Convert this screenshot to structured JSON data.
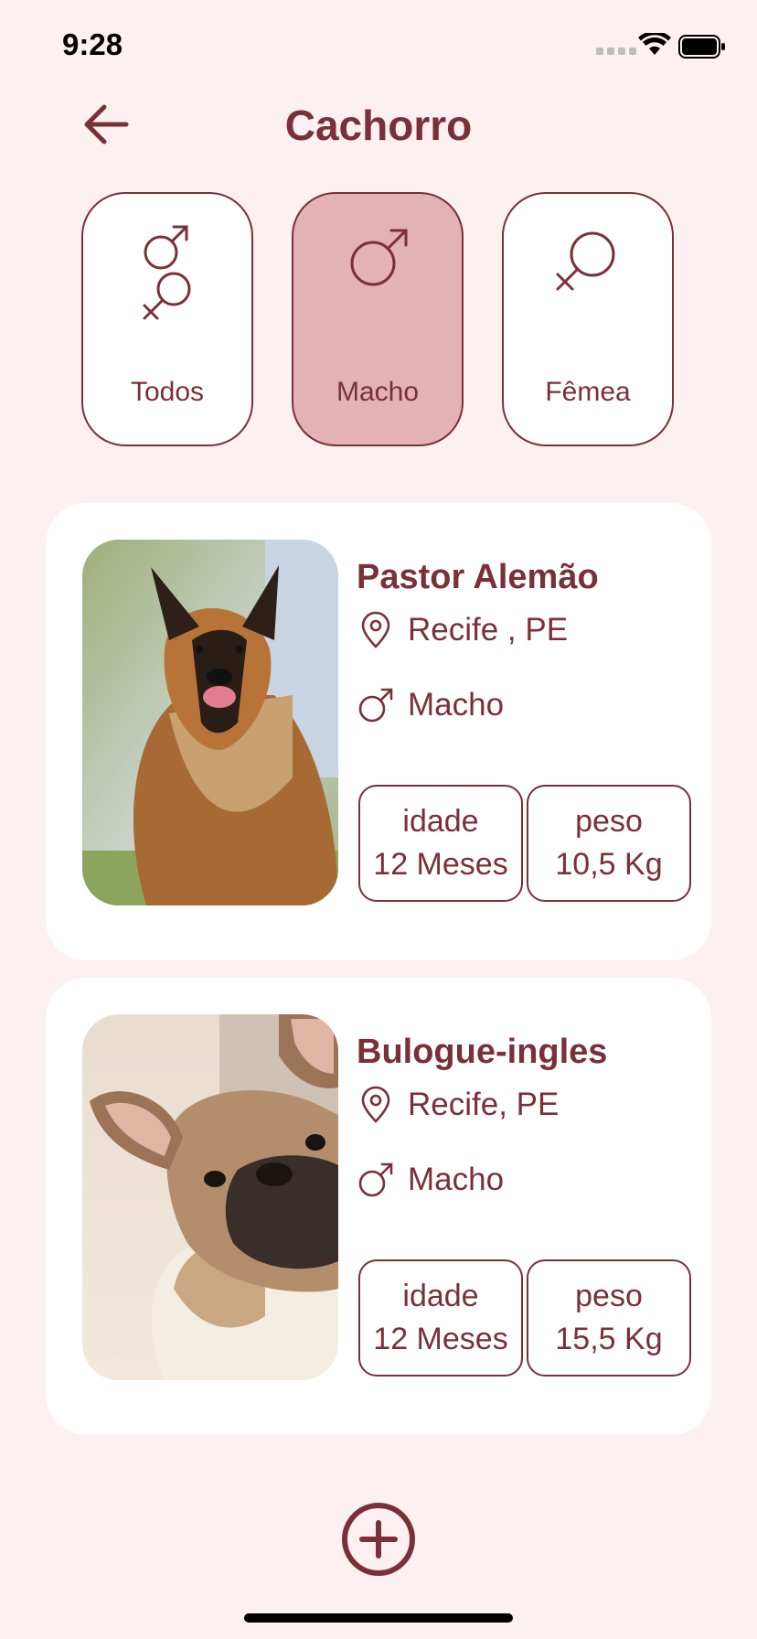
{
  "status_bar": {
    "time": "9:28"
  },
  "header": {
    "title": "Cachorro"
  },
  "filters": [
    {
      "label": "Todos",
      "icon": "male-female-icon",
      "active": false
    },
    {
      "label": "Macho",
      "icon": "male-icon",
      "active": true
    },
    {
      "label": "Fêmea",
      "icon": "female-icon",
      "active": false
    }
  ],
  "pets": [
    {
      "name": "Pastor Alemão",
      "location": "Recife , PE",
      "sex": "Macho",
      "age_label": "idade",
      "age_value": "12 Meses",
      "weight_label": "peso",
      "weight_value": "10,5 Kg"
    },
    {
      "name": "Bulogue-ingles",
      "location": "Recife, PE",
      "sex": "Macho",
      "age_label": "idade",
      "age_value": "12 Meses",
      "weight_label": "peso",
      "weight_value": "15,5 Kg"
    }
  ],
  "colors": {
    "accent": "#7a3038",
    "active_filter": "#e2b2b6",
    "background": "#fdf0f0",
    "card": "#ffffff"
  }
}
